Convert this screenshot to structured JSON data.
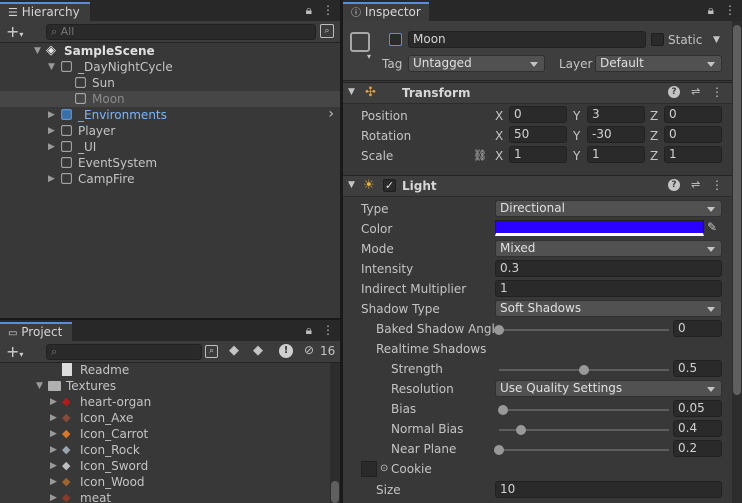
{
  "hierarchy": {
    "tab_label": "Hierarchy",
    "search_placeholder": "All",
    "rows": [
      {
        "label": "SampleScene",
        "indent": 0,
        "arrow": "▼",
        "icon": "unity-scene-icon",
        "bold": true
      },
      {
        "label": "_DayNightCycle",
        "indent": 1,
        "arrow": "▼",
        "icon": "gameobject-cube-icon"
      },
      {
        "label": "Sun",
        "indent": 2,
        "arrow": "",
        "icon": "gameobject-cube-icon"
      },
      {
        "label": "Moon",
        "indent": 2,
        "arrow": "",
        "icon": "gameobject-cube-icon",
        "selected": true,
        "dim": true
      },
      {
        "label": "_Environments",
        "indent": 1,
        "arrow": "▶",
        "icon": "prefab-cube-icon",
        "prefab": true
      },
      {
        "label": "Player",
        "indent": 1,
        "arrow": "▶",
        "icon": "gameobject-cube-icon"
      },
      {
        "label": "_UI",
        "indent": 1,
        "arrow": "▶",
        "icon": "gameobject-cube-icon"
      },
      {
        "label": "EventSystem",
        "indent": 1,
        "arrow": "",
        "icon": "gameobject-cube-icon"
      },
      {
        "label": "CampFire",
        "indent": 1,
        "arrow": "▶",
        "icon": "gameobject-cube-icon"
      }
    ]
  },
  "project": {
    "tab_label": "Project",
    "hidden_count": "16",
    "rows": [
      {
        "label": "Readme",
        "indent": 2,
        "arrow": "",
        "icon": "readme-icon"
      },
      {
        "label": "Textures",
        "indent": 1,
        "arrow": "▼",
        "icon": "folder-icon"
      },
      {
        "label": "heart-organ",
        "indent": 2,
        "arrow": "▶",
        "icon": "texture-heart-icon",
        "color": "#b31b1b"
      },
      {
        "label": "Icon_Axe",
        "indent": 2,
        "arrow": "▶",
        "icon": "texture-axe-icon",
        "color": "#8a4a3a"
      },
      {
        "label": "Icon_Carrot",
        "indent": 2,
        "arrow": "▶",
        "icon": "texture-carrot-icon",
        "color": "#d8762a"
      },
      {
        "label": "Icon_Rock",
        "indent": 2,
        "arrow": "▶",
        "icon": "texture-rock-icon",
        "color": "#9aa4ad"
      },
      {
        "label": "Icon_Sword",
        "indent": 2,
        "arrow": "▶",
        "icon": "texture-sword-icon",
        "color": "#bdbdbd"
      },
      {
        "label": "Icon_Wood",
        "indent": 2,
        "arrow": "▶",
        "icon": "texture-wood-icon",
        "color": "#a0652e"
      },
      {
        "label": "meat",
        "indent": 2,
        "arrow": "▶",
        "icon": "texture-meat-icon",
        "color": "#8c3a2a"
      }
    ]
  },
  "inspector": {
    "tab_label": "Inspector",
    "object_name": "Moon",
    "static_label": "Static",
    "tag_label": "Tag",
    "tag_value": "Untagged",
    "layer_label": "Layer",
    "layer_value": "Default",
    "transform": {
      "title": "Transform",
      "rows": [
        {
          "label": "Position",
          "x": "0",
          "y": "3",
          "z": "0"
        },
        {
          "label": "Rotation",
          "x": "50",
          "y": "-30",
          "z": "0"
        },
        {
          "label": "Scale",
          "x": "1",
          "y": "1",
          "z": "1"
        }
      ],
      "axis_x": "X",
      "axis_y": "Y",
      "axis_z": "Z"
    },
    "light": {
      "title": "Light",
      "enabled": true,
      "type_label": "Type",
      "type_value": "Directional",
      "color_label": "Color",
      "color_value": "#2a00ff",
      "mode_label": "Mode",
      "mode_value": "Mixed",
      "intensity_label": "Intensity",
      "intensity_value": "0.3",
      "indirect_label": "Indirect Multiplier",
      "indirect_value": "1",
      "shadow_type_label": "Shadow Type",
      "shadow_type_value": "Soft Shadows",
      "baked_angle_label": "Baked Shadow Angle",
      "baked_angle_value": "0",
      "baked_angle_frac": 0.0,
      "realtime_label": "Realtime Shadows",
      "strength_label": "Strength",
      "strength_value": "0.5",
      "strength_frac": 0.5,
      "resolution_label": "Resolution",
      "resolution_value": "Use Quality Settings",
      "bias_label": "Bias",
      "bias_value": "0.05",
      "bias_frac": 0.025,
      "normal_bias_label": "Normal Bias",
      "normal_bias_value": "0.4",
      "normal_bias_frac": 0.13,
      "near_plane_label": "Near Plane",
      "near_plane_value": "0.2",
      "near_plane_frac": 0.0,
      "cookie_label": "Cookie",
      "size_label": "Size",
      "size_value": "10"
    }
  }
}
